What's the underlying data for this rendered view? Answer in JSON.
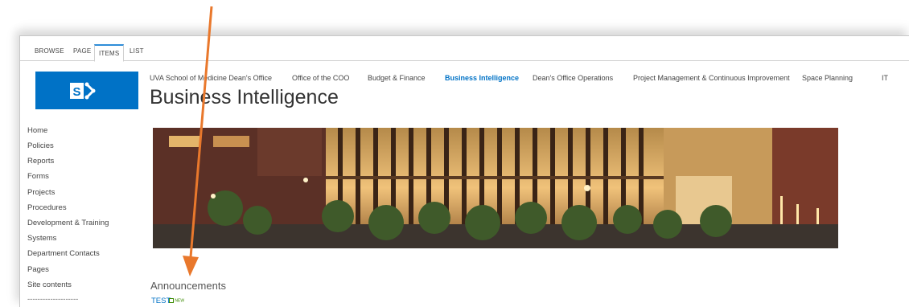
{
  "ribbon": {
    "tabs": [
      {
        "label": "BROWSE"
      },
      {
        "label": "PAGE"
      },
      {
        "label": "ITEMS"
      },
      {
        "label": "LIST"
      }
    ]
  },
  "top_nav": [
    {
      "label": "UVA School of Medicine Dean's Office"
    },
    {
      "label": "Office of the COO"
    },
    {
      "label": "Budget & Finance"
    },
    {
      "label": "Business Intelligence"
    },
    {
      "label": "Dean's Office Operations"
    },
    {
      "label": "Project Management & Continuous Improvement"
    },
    {
      "label": "Space Planning"
    },
    {
      "label": "IT"
    }
  ],
  "page_title": "Business Intelligence",
  "quick_launch": [
    {
      "label": "Home"
    },
    {
      "label": "Policies"
    },
    {
      "label": "Reports"
    },
    {
      "label": "Forms"
    },
    {
      "label": "Projects"
    },
    {
      "label": "Procedures"
    },
    {
      "label": "Development & Training"
    },
    {
      "label": "Systems"
    },
    {
      "label": "Department Contacts"
    },
    {
      "label": "Pages"
    },
    {
      "label": "Site contents"
    },
    {
      "label": "--------------------"
    }
  ],
  "announcements": {
    "heading": "Announcements",
    "items": [
      {
        "title": "TEST",
        "badge": "NEW"
      }
    ]
  },
  "colors": {
    "brand": "#0072c6",
    "annotation_arrow": "#e9782c"
  }
}
